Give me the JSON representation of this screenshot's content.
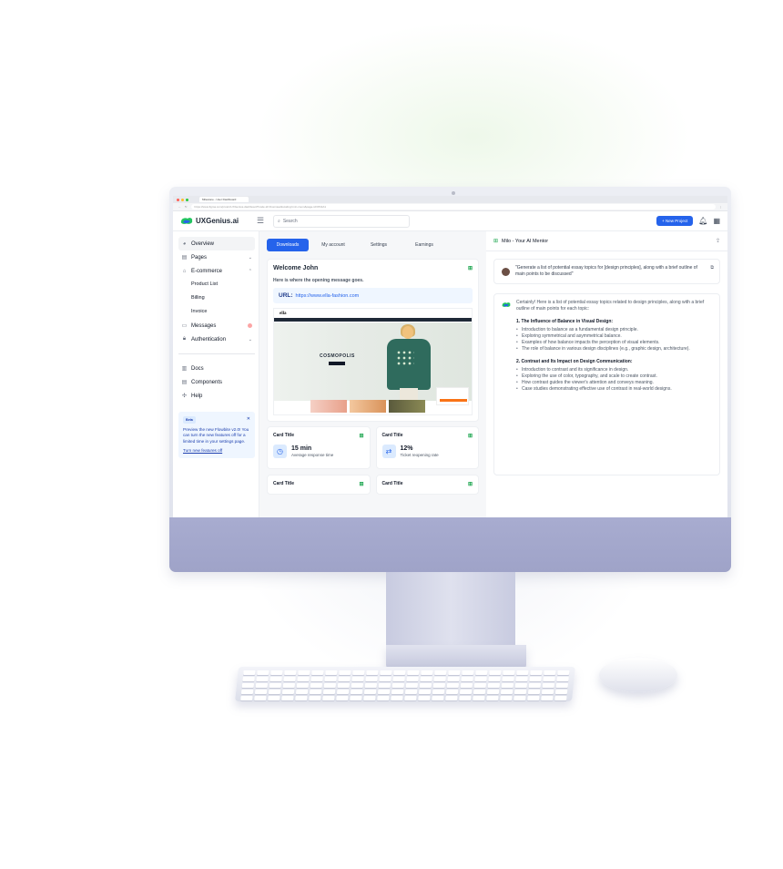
{
  "browser": {
    "tab_title": "Milestone - User Dashboard",
    "url": "https://www.figma.com/proto/xUXGenius-dashboard?node-id=Overview&scaling=min-zoom&page-id=0%3A1"
  },
  "header": {
    "brand": "UXGenius.ai",
    "search_placeholder": "Search",
    "new_project_label": "+ New Project"
  },
  "sidebar": {
    "items": [
      {
        "label": "Overview"
      },
      {
        "label": "Pages"
      },
      {
        "label": "E-commerce"
      },
      {
        "label": "Messages"
      },
      {
        "label": "Authentication"
      },
      {
        "label": "Docs"
      },
      {
        "label": "Components"
      },
      {
        "label": "Help"
      }
    ],
    "ecommerce_sub": [
      "Product List",
      "Billing",
      "Invoice"
    ],
    "promo": {
      "badge": "Beta",
      "text": "Preview the new Flowbite v2.0! You can turn the new features off for a limited time in your settings page.",
      "link": "Turn new features off"
    }
  },
  "main": {
    "tabs": [
      "Downloads",
      "My account",
      "Settings",
      "Earnings"
    ],
    "welcome_title": "Welcome John",
    "welcome_sub": "Here is where the opening message goes.",
    "url_label": "URL:",
    "url_value": "https://www.ella-fashion.com",
    "preview": {
      "logo": "ella",
      "hero_title": "COSMOPOLIS"
    },
    "cards": [
      {
        "title": "Card Title",
        "value": "15 min",
        "label": "Average response time"
      },
      {
        "title": "Card Title",
        "value": "12%",
        "label": "Ticket reopening rate"
      },
      {
        "title": "Card Title"
      },
      {
        "title": "Card Title"
      }
    ]
  },
  "ai": {
    "title": "Milo - Your AI Mentor",
    "prompt": "\"Generate a list of potential essay topics for [design principles], along with a brief outline of main points to be discussed\"",
    "intro": "Certainly! Here is a list of potential essay topics related to design principles, along with a brief outline of main points for each topic:",
    "sections": [
      {
        "heading": "1. The Influence of Balance in Visual Design:",
        "points": [
          "Introduction to balance as a fundamental design principle.",
          "Exploring symmetrical and asymmetrical balance.",
          "Examples of how balance impacts the perception of visual elements.",
          "The role of balance in various design disciplines (e.g., graphic design, architecture)."
        ]
      },
      {
        "heading": "2. Contrast and Its Impact on Design Communication:",
        "points": [
          "Introduction to contrast and its significance in design.",
          "Exploring the use of color, typography, and scale to create contrast.",
          "How contrast guides the viewer's attention and conveys meaning.",
          "Case studies demonstrating effective use of contrast in real-world designs."
        ]
      }
    ]
  },
  "colors": {
    "accent": "#2563eb",
    "chin": "#a8acd0",
    "logo_green": "#22c55e",
    "logo_blue": "#2563eb"
  }
}
